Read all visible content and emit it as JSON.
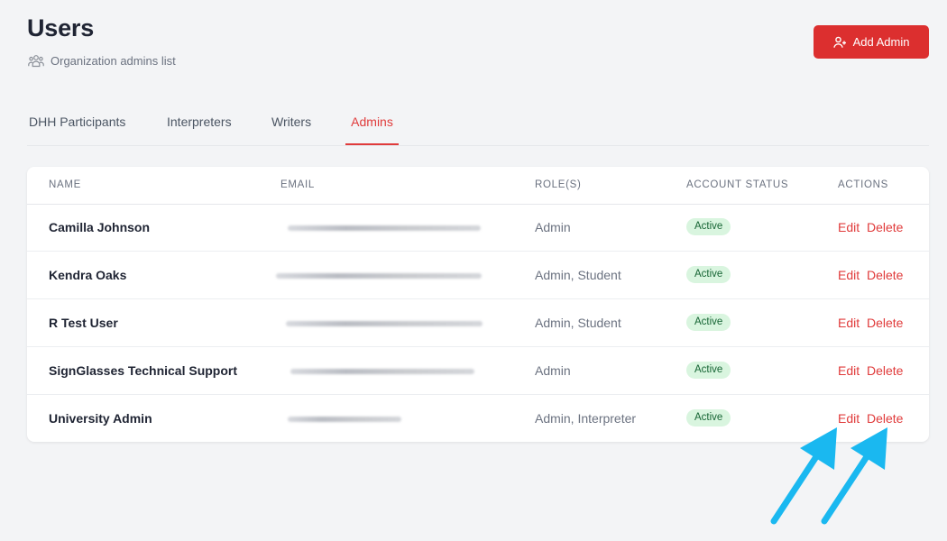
{
  "header": {
    "title": "Users",
    "subtitle": "Organization admins list",
    "subtitle_icon": "users-group-icon",
    "add_button_label": "Add Admin",
    "add_button_icon": "user-plus-icon"
  },
  "tabs": [
    {
      "label": "DHH Participants",
      "active": false
    },
    {
      "label": "Interpreters",
      "active": false
    },
    {
      "label": "Writers",
      "active": false
    },
    {
      "label": "Admins",
      "active": true
    }
  ],
  "table": {
    "columns": [
      "NAME",
      "EMAIL",
      "ROLE(S)",
      "ACCOUNT STATUS",
      "ACTIONS"
    ],
    "rows": [
      {
        "name": "Camilla Johnson",
        "roles": "Admin",
        "status": "Active",
        "edit": "Edit",
        "delete": "Delete"
      },
      {
        "name": "Kendra Oaks",
        "roles": "Admin, Student",
        "status": "Active",
        "edit": "Edit",
        "delete": "Delete"
      },
      {
        "name": "R Test User",
        "roles": "Admin, Student",
        "status": "Active",
        "edit": "Edit",
        "delete": "Delete"
      },
      {
        "name": "SignGlasses Technical Support",
        "roles": "Admin",
        "status": "Active",
        "edit": "Edit",
        "delete": "Delete"
      },
      {
        "name": "University Admin",
        "roles": "Admin, Interpreter",
        "status": "Active",
        "edit": "Edit",
        "delete": "Delete"
      }
    ]
  },
  "colors": {
    "accent": "#dc2f2f",
    "status_active_bg": "#d9f5df",
    "status_active_text": "#166534",
    "annotation_arrow": "#1ab8f0"
  }
}
